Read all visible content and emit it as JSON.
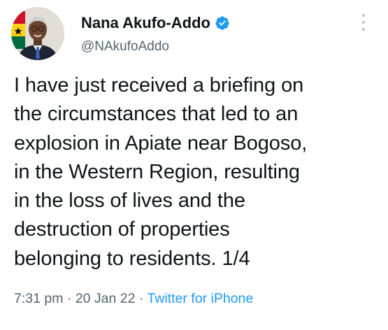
{
  "author": {
    "display_name": "Nana Akufo-Addo",
    "handle": "@NAkufoAddo"
  },
  "tweet": {
    "lines": [
      "I have just received a briefing on",
      "the circumstances that led to an",
      "explosion in Apiate near Bogoso,",
      "in the Western Region, resulting",
      "in the loss of lives and the",
      "destruction of properties",
      "belonging to residents. 1/4"
    ],
    "time": "7:31 pm",
    "date": "20 Jan 22",
    "source": "Twitter for iPhone",
    "separator": "·"
  },
  "icons": {
    "verified": "verified-badge-icon",
    "more": "more-options-icon"
  },
  "colors": {
    "text": "#0f1419",
    "secondary": "#536471",
    "accent": "#1d9bf0"
  }
}
